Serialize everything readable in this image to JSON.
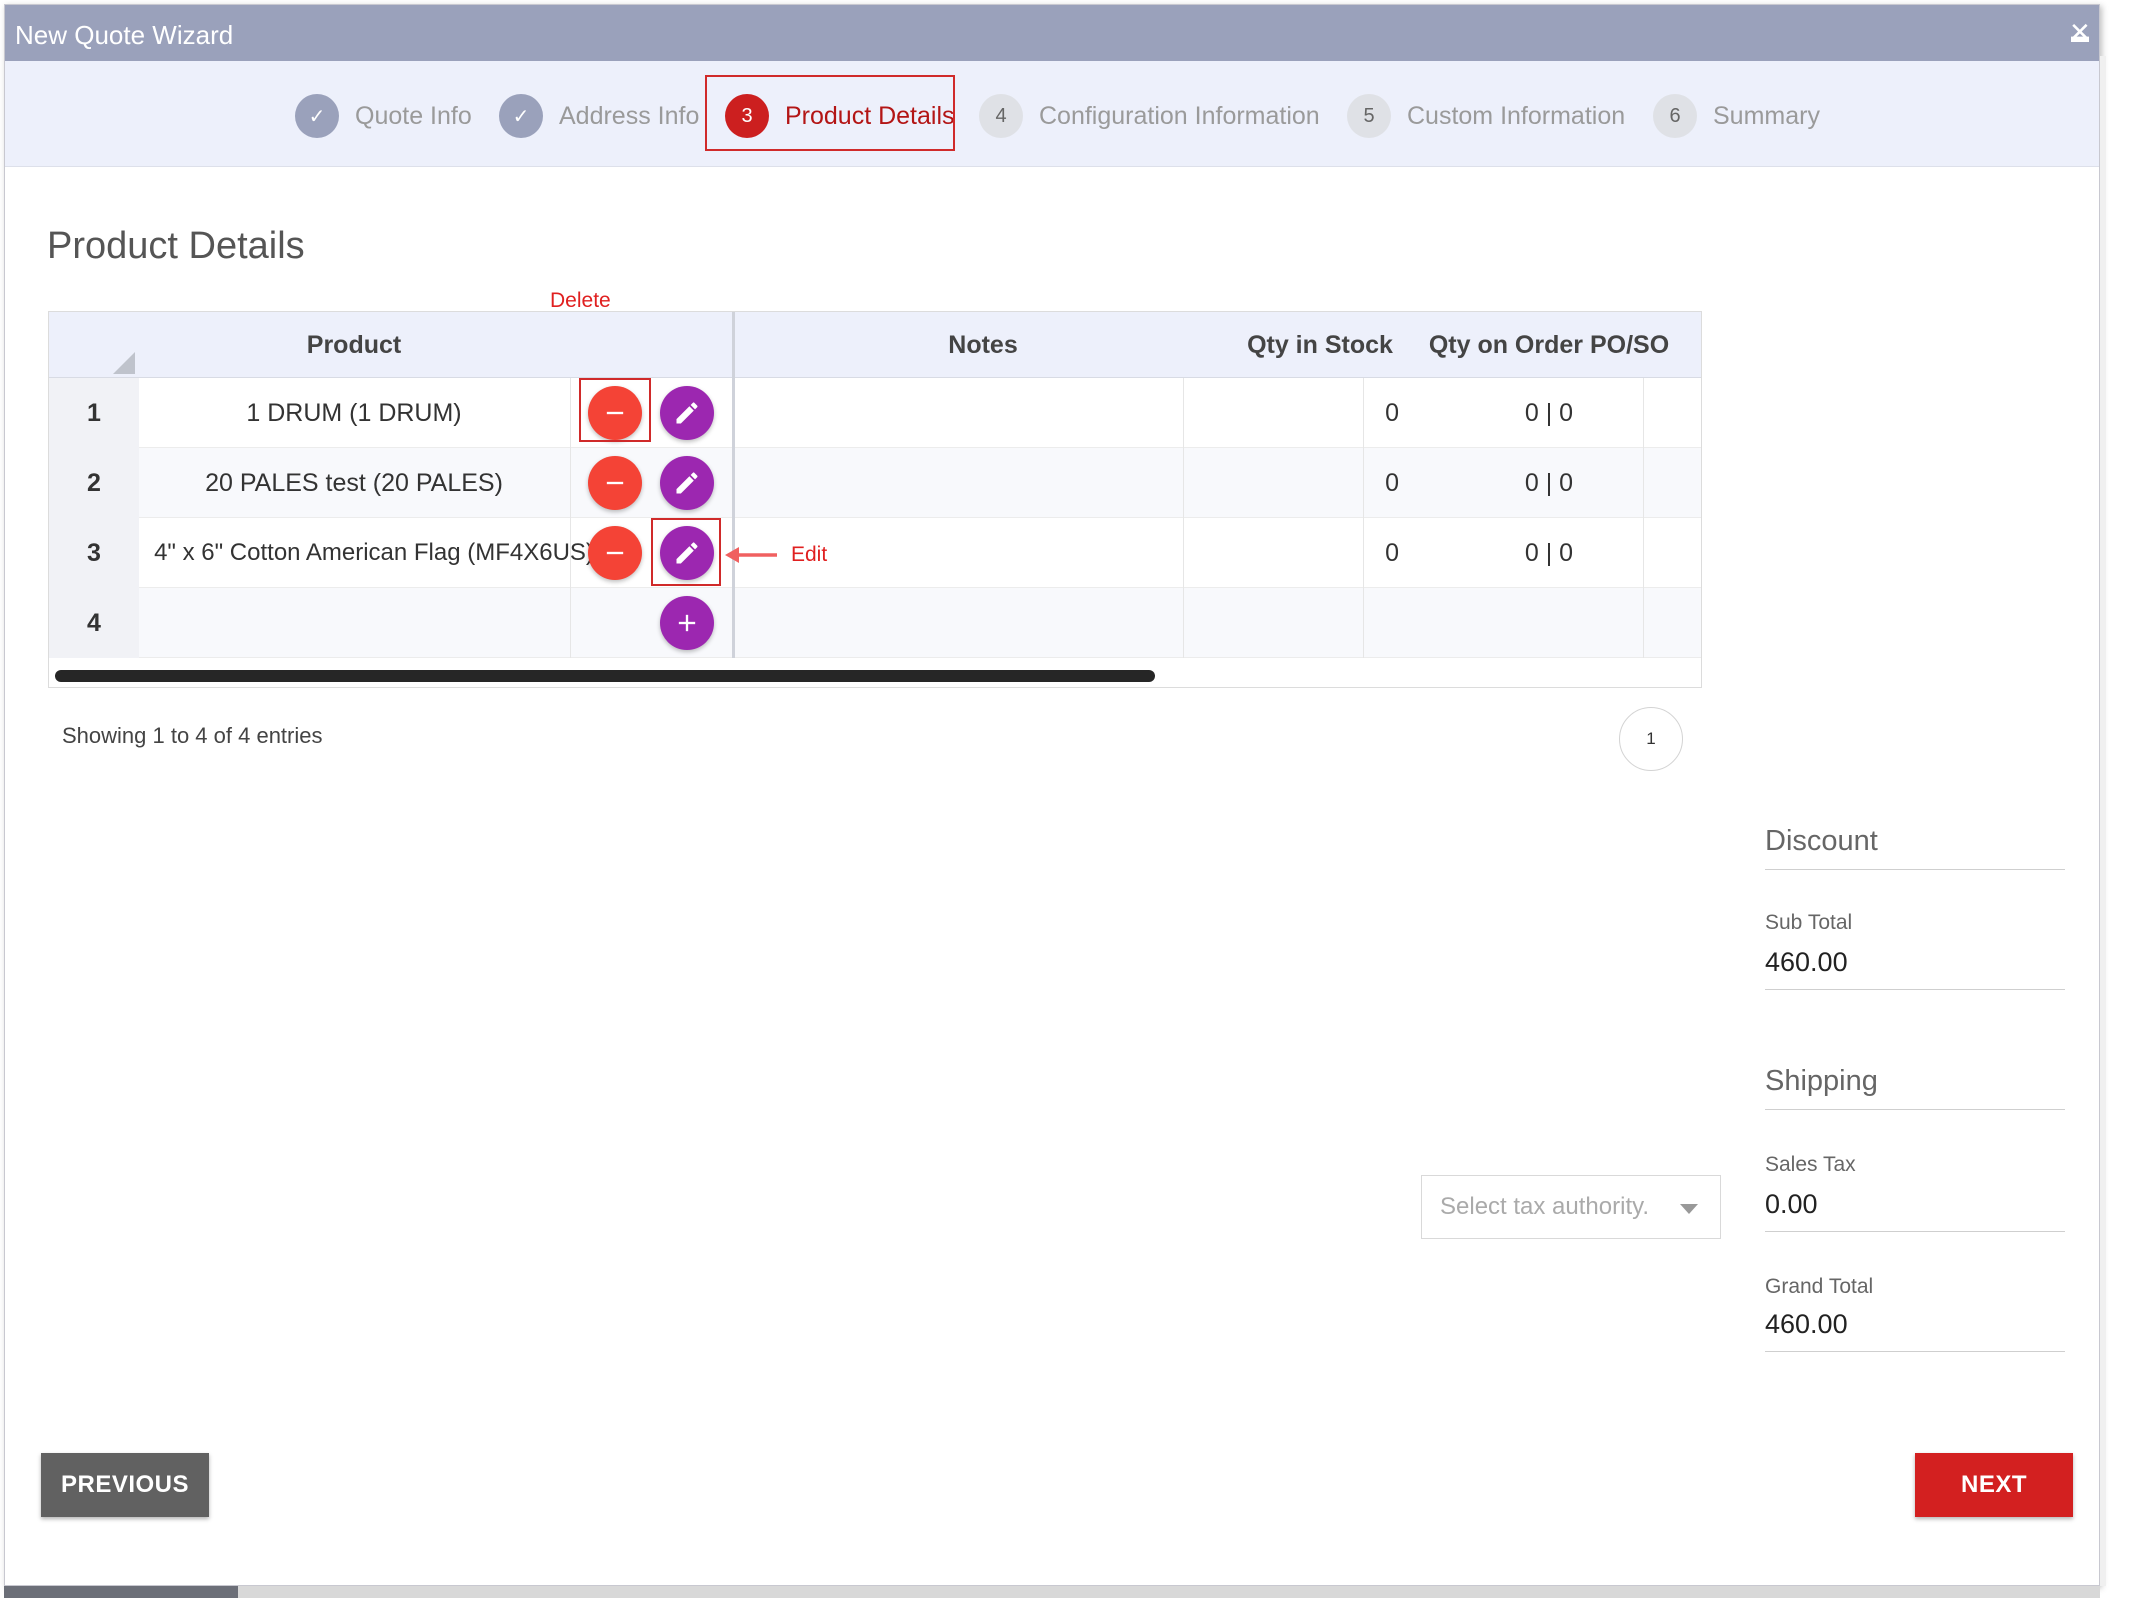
{
  "window": {
    "title": "New Quote Wizard",
    "minimize": "▬",
    "close": "✕"
  },
  "stepper": {
    "steps": [
      {
        "num": "✓",
        "label": "Quote Info",
        "state": "done"
      },
      {
        "num": "✓",
        "label": "Address Info",
        "state": "done"
      },
      {
        "num": "3",
        "label": "Product Details",
        "state": "active"
      },
      {
        "num": "4",
        "label": "Configuration Information",
        "state": "todo"
      },
      {
        "num": "5",
        "label": "Custom Information",
        "state": "todo"
      },
      {
        "num": "6",
        "label": "Summary",
        "state": "todo"
      }
    ]
  },
  "page": {
    "heading": "Product Details"
  },
  "annotations": {
    "delete": "Delete",
    "edit": "Edit"
  },
  "grid": {
    "columns": {
      "product": "Product",
      "notes": "Notes",
      "qty_stock": "Qty in Stock",
      "qty_order": "Qty on Order PO/SO"
    },
    "rows": [
      {
        "num": "1",
        "product": "1 DRUM (1 DRUM)",
        "notes": "",
        "qty_stock": "0",
        "qty_order": "0 | 0"
      },
      {
        "num": "2",
        "product": "20 PALES test (20 PALES)",
        "notes": "",
        "qty_stock": "0",
        "qty_order": "0 | 0"
      },
      {
        "num": "3",
        "product": "4\" x 6\" Cotton American Flag (MF4X6US)",
        "notes": "",
        "qty_stock": "0",
        "qty_order": "0 | 0"
      },
      {
        "num": "4",
        "product": "",
        "notes": "",
        "qty_stock": "",
        "qty_order": ""
      }
    ]
  },
  "pagination": {
    "info": "Showing 1 to 4 of 4 entries",
    "page": "1"
  },
  "summary": {
    "discount_label": "Discount",
    "subtotal_label": "Sub Total",
    "subtotal_value": "460.00",
    "shipping_label": "Shipping",
    "salestax_label": "Sales Tax",
    "salestax_value": "0.00",
    "grandtotal_label": "Grand Total",
    "grandtotal_value": "460.00"
  },
  "tax_select": {
    "placeholder": "Select tax authority."
  },
  "buttons": {
    "previous": "PREVIOUS",
    "next": "NEXT"
  },
  "colors": {
    "titlebar": "#9aa1bb",
    "accent_red": "#d32020",
    "fab_red": "#f44336",
    "fab_purple": "#9c27b0",
    "stepper_bg": "#edf0fb"
  }
}
